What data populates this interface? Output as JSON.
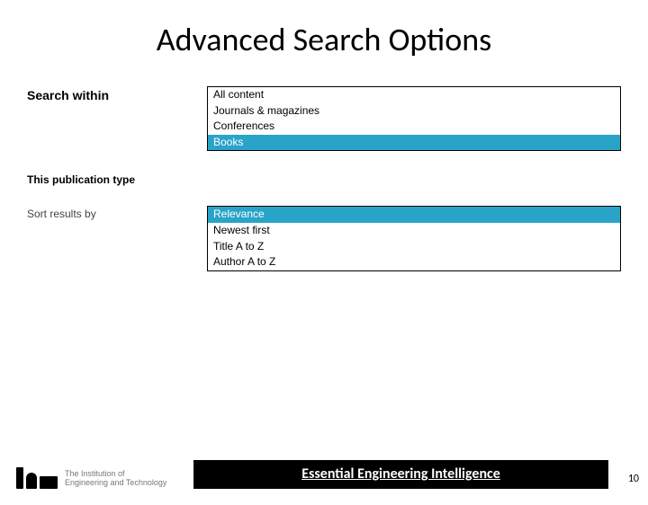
{
  "title": "Advanced Search Options",
  "sections": {
    "search_within": {
      "label": "Search within",
      "options": [
        "All content",
        "Journals & magazines",
        "Conferences",
        "Books"
      ],
      "selected": "Books"
    },
    "pub_type": {
      "label": "This publication type"
    },
    "sort_by": {
      "label": "Sort results by",
      "options": [
        "Relevance",
        "Newest first",
        "Title A to Z",
        "Author A to Z"
      ],
      "selected": "Relevance"
    }
  },
  "footer": {
    "logo_line1": "The Institution of",
    "logo_line2": "Engineering and Technology",
    "bar_text": "Essential Engineering Intelligence",
    "page": "10"
  }
}
